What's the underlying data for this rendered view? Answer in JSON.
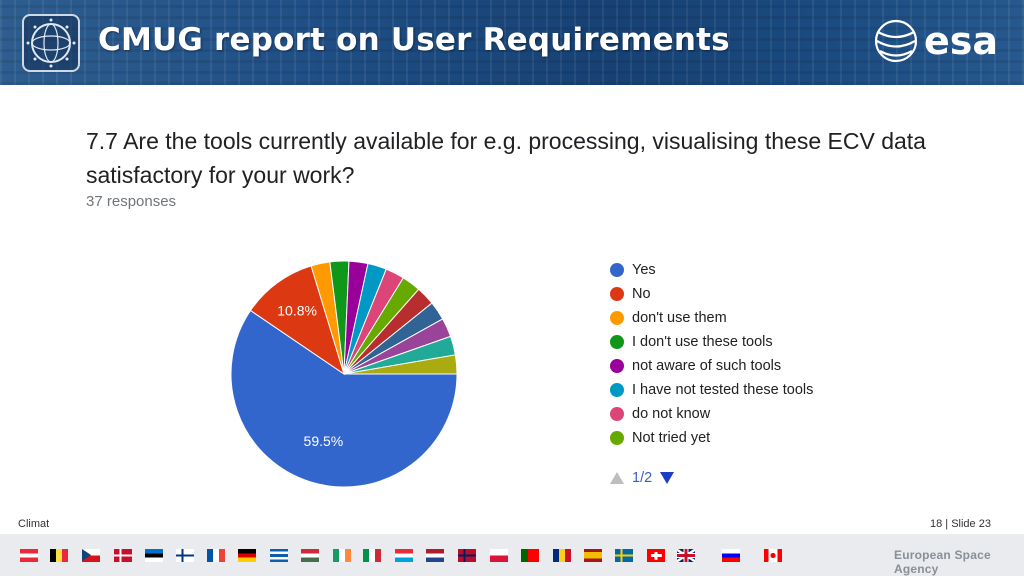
{
  "header": {
    "title": "CMUG report on User Requirements",
    "logo_icon": "cci-globe-icon",
    "brand": "esa"
  },
  "question": {
    "text": "7.7 Are the tools currently available for e.g. processing, visualising these ECV data satisfactory for your work?",
    "responses": "37 responses"
  },
  "chart_data": {
    "type": "pie",
    "slices": [
      {
        "label": "Yes",
        "value": 59.5,
        "color": "#3366cc",
        "data_label": "59.5%"
      },
      {
        "label": "No",
        "value": 10.8,
        "color": "#dc3912",
        "data_label": "10.8%"
      },
      {
        "label": "don't use them",
        "value": 2.7,
        "color": "#ff9900"
      },
      {
        "label": "I don't use these tools",
        "value": 2.7,
        "color": "#109618"
      },
      {
        "label": "not aware of such tools",
        "value": 2.7,
        "color": "#990099"
      },
      {
        "label": "I have not tested these tools",
        "value": 2.7,
        "color": "#0099c6"
      },
      {
        "label": "do not know",
        "value": 2.7,
        "color": "#dd4477"
      },
      {
        "label": "Not tried yet",
        "value": 2.7,
        "color": "#66aa00"
      },
      {
        "label": "",
        "value": 2.7,
        "color": "#b82e2e"
      },
      {
        "label": "",
        "value": 2.7,
        "color": "#316395"
      },
      {
        "label": "",
        "value": 2.7,
        "color": "#994499"
      },
      {
        "label": "",
        "value": 2.7,
        "color": "#22aa99"
      },
      {
        "label": "",
        "value": 2.7,
        "color": "#aaaa11"
      }
    ],
    "legend_placement": "right",
    "legend_page": "1/2"
  },
  "footer": {
    "left": "Climat",
    "slide": "18 | Slide  23",
    "agency": "European Space Agency"
  },
  "flags": [
    {
      "name": "austria-flag",
      "bands": "h",
      "colors": [
        "#ed2939",
        "#ffffff",
        "#ed2939"
      ]
    },
    {
      "name": "belgium-flag",
      "bands": "v",
      "colors": [
        "#000000",
        "#fae042",
        "#ed2939"
      ]
    },
    {
      "name": "czech-flag",
      "bands": "cz",
      "colors": [
        "#ffffff",
        "#d7141a",
        "#11457e"
      ]
    },
    {
      "name": "denmark-flag",
      "bands": "cross",
      "colors": [
        "#c8102e",
        "#ffffff"
      ]
    },
    {
      "name": "estonia-flag",
      "bands": "h",
      "colors": [
        "#0072ce",
        "#000000",
        "#ffffff"
      ]
    },
    {
      "name": "finland-flag",
      "bands": "cross",
      "colors": [
        "#ffffff",
        "#003580"
      ]
    },
    {
      "name": "france-flag",
      "bands": "v",
      "colors": [
        "#0055a4",
        "#ffffff",
        "#ef4135"
      ]
    },
    {
      "name": "germany-flag",
      "bands": "h",
      "colors": [
        "#000000",
        "#dd0000",
        "#ffce00"
      ]
    },
    {
      "name": "greece-flag",
      "bands": "h",
      "colors": [
        "#0d5eaf",
        "#ffffff",
        "#0d5eaf",
        "#ffffff",
        "#0d5eaf"
      ]
    },
    {
      "name": "hungary-flag",
      "bands": "h",
      "colors": [
        "#cd2a3e",
        "#ffffff",
        "#436f4d"
      ]
    },
    {
      "name": "ireland-flag",
      "bands": "v",
      "colors": [
        "#169b62",
        "#ffffff",
        "#ff883e"
      ]
    },
    {
      "name": "italy-flag",
      "bands": "v",
      "colors": [
        "#009246",
        "#ffffff",
        "#ce2b37"
      ]
    },
    {
      "name": "luxembourg-flag",
      "bands": "h",
      "colors": [
        "#ed2939",
        "#ffffff",
        "#00a1de"
      ]
    },
    {
      "name": "netherlands-flag",
      "bands": "h",
      "colors": [
        "#ae1c28",
        "#ffffff",
        "#21468b"
      ]
    },
    {
      "name": "norway-flag",
      "bands": "cross",
      "colors": [
        "#ba0c2f",
        "#00205b"
      ]
    },
    {
      "name": "poland-flag",
      "bands": "h",
      "colors": [
        "#ffffff",
        "#dc143c"
      ]
    },
    {
      "name": "portugal-flag",
      "bands": "pt",
      "colors": [
        "#006600",
        "#ff0000"
      ]
    },
    {
      "name": "romania-flag",
      "bands": "v",
      "colors": [
        "#002b7f",
        "#fcd116",
        "#ce1126"
      ]
    },
    {
      "name": "spain-flag",
      "bands": "es",
      "colors": [
        "#aa151b",
        "#f1bf00",
        "#aa151b"
      ]
    },
    {
      "name": "sweden-flag",
      "bands": "cross",
      "colors": [
        "#006aa7",
        "#fecc00"
      ]
    },
    {
      "name": "switzerland-flag",
      "bands": "ch",
      "colors": [
        "#ff0000",
        "#ffffff"
      ]
    },
    {
      "name": "uk-flag",
      "bands": "uk",
      "colors": [
        "#012169",
        "#ffffff",
        "#c8102e"
      ]
    },
    {
      "name": "slovenia-flag",
      "bands": "h",
      "colors": [
        "#ffffff",
        "#0000ff",
        "#ff0000"
      ]
    },
    {
      "name": "canada-flag",
      "bands": "ca",
      "colors": [
        "#ff0000",
        "#ffffff"
      ]
    }
  ]
}
